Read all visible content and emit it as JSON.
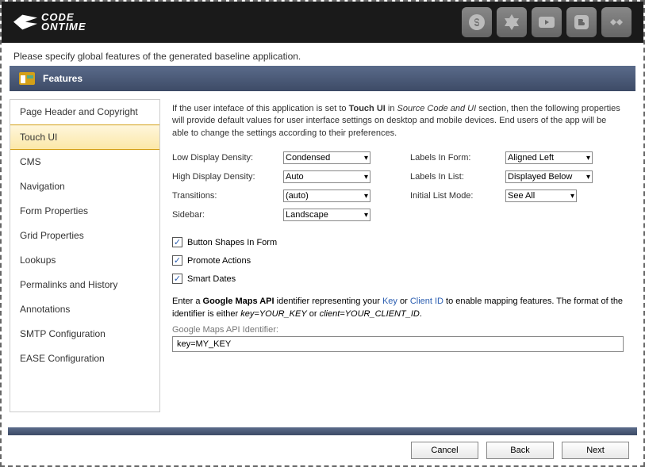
{
  "header": {
    "logo_line1": "CODE",
    "logo_line2": "ONTIME"
  },
  "subtitle": "Please specify global features of the generated baseline application.",
  "section_title": "Features",
  "sidebar": {
    "items": [
      {
        "label": "Page Header and Copyright"
      },
      {
        "label": "Touch UI"
      },
      {
        "label": "CMS"
      },
      {
        "label": "Navigation"
      },
      {
        "label": "Form Properties"
      },
      {
        "label": "Grid Properties"
      },
      {
        "label": "Lookups"
      },
      {
        "label": "Permalinks and History"
      },
      {
        "label": "Annotations"
      },
      {
        "label": "SMTP Configuration"
      },
      {
        "label": "EASE Configuration"
      }
    ],
    "active_index": 1
  },
  "content": {
    "intro_pre": "If the user inteface of this application is set to ",
    "intro_bold1": "Touch UI",
    "intro_mid": " in ",
    "intro_italic": "Source Code and UI",
    "intro_post": " section, then the following properties will provide default values for user interface settings on desktop and mobile devices. End users of the app will be able to change the settings according to their preferences.",
    "fields": {
      "low_density_label": "Low Display Density:",
      "low_density_value": "Condensed",
      "high_density_label": "High Display Density:",
      "high_density_value": "Auto",
      "transitions_label": "Transitions:",
      "transitions_value": "(auto)",
      "sidebar_label": "Sidebar:",
      "sidebar_value": "Landscape",
      "labels_form_label": "Labels In Form:",
      "labels_form_value": "Aligned Left",
      "labels_list_label": "Labels In List:",
      "labels_list_value": "Displayed Below",
      "initial_list_label": "Initial List Mode:",
      "initial_list_value": "See All"
    },
    "checkboxes": {
      "button_shapes": "Button Shapes In Form",
      "promote_actions": "Promote Actions",
      "smart_dates": "Smart Dates"
    },
    "maps_pre": "Enter a ",
    "maps_bold": "Google Maps API",
    "maps_mid1": " identifier representing your ",
    "maps_link1": "Key",
    "maps_or": " or ",
    "maps_link2": "Client ID",
    "maps_mid2": " to enable mapping features. The format of the identifier is either ",
    "maps_italic1": "key=YOUR_KEY",
    "maps_or2": " or ",
    "maps_italic2": "client=YOUR_CLIENT_ID",
    "maps_period": ".",
    "api_label": "Google Maps API Identifier:",
    "api_value": "key=MY_KEY"
  },
  "footer": {
    "cancel": "Cancel",
    "back": "Back",
    "next": "Next"
  }
}
